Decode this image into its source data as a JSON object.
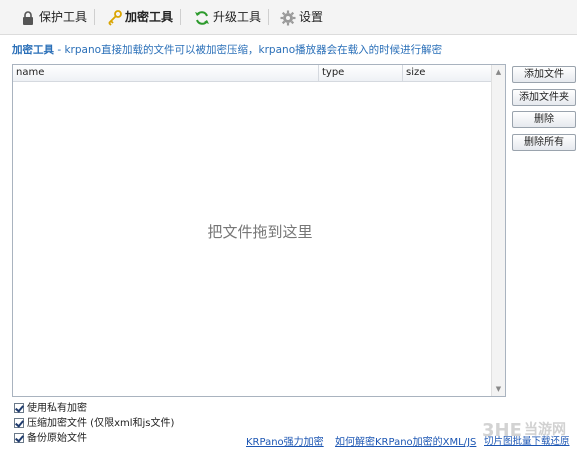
{
  "toolbar": {
    "items": [
      {
        "label": "保护工具",
        "icon": "lock-icon"
      },
      {
        "label": "加密工具",
        "icon": "key-icon"
      },
      {
        "label": "升级工具",
        "icon": "refresh-icon"
      },
      {
        "label": "设置",
        "icon": "gear-icon"
      }
    ],
    "active": "加密工具"
  },
  "description": {
    "title": "加密工具",
    "text": " - krpano直接加载的文件可以被加密压缩，krpano播放器会在载入的时候进行解密"
  },
  "filelist": {
    "columns": [
      "name",
      "type",
      "size"
    ],
    "empty_hint": "把文件拖到这里"
  },
  "buttons": {
    "add_file": "添加文件",
    "add_folder": "添加文件夹",
    "delete": "删除",
    "delete_all": "删除所有"
  },
  "options": [
    {
      "label": "使用私有加密",
      "checked": true
    },
    {
      "label": "压缩加密文件 (仅限xml和js文件)",
      "checked": true
    },
    {
      "label": "备份原始文件",
      "checked": true
    }
  ],
  "links": {
    "krpano_encrypt": "KRPano强力加密",
    "how_decrypt": "如何解密KRPano加密的XML/JS",
    "batch_download": "切片图批量下载还原"
  },
  "watermark": {
    "text": "当游网"
  },
  "colors": {
    "accent": "#2a6fb8",
    "link": "#1c56b3"
  }
}
